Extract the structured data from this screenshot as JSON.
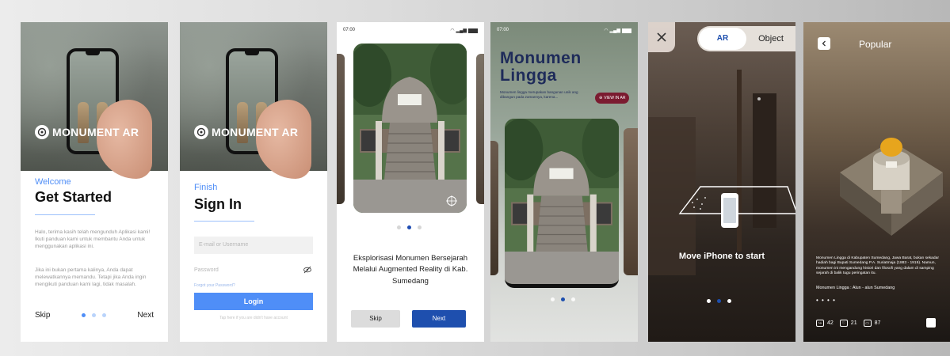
{
  "brand": {
    "name": "MONUMENT AR"
  },
  "onboarding": {
    "eyebrow": "Welcome",
    "title": "Get Started",
    "paragraph1": "Halo, terima kasih telah mengunduh Aplikasi kami! Ikuti panduan kami untuk membantu Anda untuk menggunakan aplikasi ini.",
    "paragraph2": "Jika ini bukan pertama kalinya, Anda dapat melewatkannya memandu. Tetapi jika Anda ingin mengikuti panduan kami lagi, tidak masalah.",
    "skip_label": "Skip",
    "next_label": "Next"
  },
  "signin": {
    "eyebrow": "Finish",
    "title": "Sign In",
    "email_placeholder": "E-mail or Username",
    "password_placeholder": "Password",
    "forgot_label": "Forgot your Password?",
    "login_label": "Login",
    "signup_hint": "Tap here if you are didn't have account"
  },
  "intro": {
    "time": "07:00",
    "caption": "Eksplorisasi Monumen Bersejarah Melalui Augmented Reality di Kab. Sumedang",
    "skip_label": "Skip",
    "next_label": "Next"
  },
  "detail": {
    "time": "07:00",
    "title_line1": "Monumen",
    "title_line2": "Lingga",
    "description": "Monumen lingga merupakan bangunan unik ang dibangun pada zamannya, karena...",
    "view_ar_label": "VIEW IN AR"
  },
  "ar_view": {
    "mode_ar": "AR",
    "mode_object": "Object",
    "instruction": "Move iPhone to start"
  },
  "popular": {
    "title": "Popular",
    "description": "Monumen Lingga di Kabupaten Sumedang, Jawa Barat, bukan sekadar hadiah bagi Bupati Sumedang P.A. Suriatmaja (1883 - 1919). Namun, monumen ini mengandung histori dan filosofi yang dalam di samping sejarah di balik tugu peringatan itu.",
    "location_name": "Monumen Lingga",
    "location_sep": ":",
    "location_area": "Alun - alun Sumedang",
    "more_dots": "• • • •",
    "stat_views": "42",
    "stat_likes": "21",
    "stat_comments": "87"
  },
  "colors": {
    "accent_blue": "#4f8ef7",
    "primary_navy": "#1e4fae",
    "view_ar_maroon": "#7b1b30"
  }
}
